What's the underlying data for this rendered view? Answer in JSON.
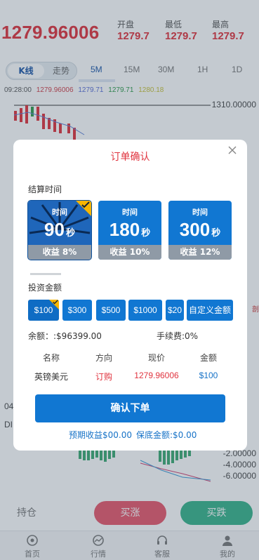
{
  "header": {
    "price": "1279.96006",
    "stats": [
      {
        "label": "开盘",
        "value": "1279.7"
      },
      {
        "label": "最低",
        "value": "1279.7"
      },
      {
        "label": "最高",
        "value": "1279.7"
      }
    ]
  },
  "chart_tabs": {
    "mode_on": "K线",
    "mode_off": "走势",
    "periods": [
      "5M",
      "15M",
      "30M",
      "1H",
      "1D"
    ],
    "active_period": "5M"
  },
  "ohlc": {
    "time": "09:28:00",
    "v1": "1279.96006",
    "v2": "1279.71",
    "v3": "1279.71",
    "v4": "1280.18"
  },
  "chart": {
    "top_price": "1310.00000",
    "left_mid_1": "04",
    "left_mid_2": "DI",
    "right_edge": "剖",
    "macd_labels": [
      "-2.00000",
      "-4.00000",
      "-6.00000"
    ]
  },
  "actions": {
    "hold": "持仓",
    "buy_up": "买涨",
    "buy_down": "买跌"
  },
  "nav": {
    "items": [
      {
        "label": "首页",
        "icon": "home-icon"
      },
      {
        "label": "行情",
        "icon": "chart-icon"
      },
      {
        "label": "客服",
        "icon": "headset-icon"
      },
      {
        "label": "我的",
        "icon": "user-icon"
      }
    ]
  },
  "modal": {
    "title": "订单确认",
    "settle_label": "结算时间",
    "cards": [
      {
        "title": "时间",
        "seconds": "90",
        "unit": "秒",
        "profit": "收益 8%",
        "selected": true
      },
      {
        "title": "时间",
        "seconds": "180",
        "unit": "秒",
        "profit": "收益 10%",
        "selected": false
      },
      {
        "title": "时间",
        "seconds": "300",
        "unit": "秒",
        "profit": "收益 12%",
        "selected": false
      }
    ],
    "amount_label": "投资金额",
    "amounts": [
      "$100",
      "$300",
      "$500",
      "$1000",
      "$20"
    ],
    "custom_amount": "自定义金额",
    "balance": "余额：:$96399.00",
    "fee": "手续费:0%",
    "table_headers": [
      "名称",
      "方向",
      "现价",
      "金额"
    ],
    "table_row": [
      "英镑美元",
      "订购",
      "1279.96006",
      "$100"
    ],
    "confirm": "确认下单",
    "expected": "预期收益$00.00",
    "margin": "保底金额:$0.00"
  },
  "colors": {
    "accent_blue": "#1177d2",
    "price_red": "#e0303a",
    "buy_up": "#e9576a",
    "buy_down": "#35b48a",
    "check_gold": "#f6b500"
  }
}
